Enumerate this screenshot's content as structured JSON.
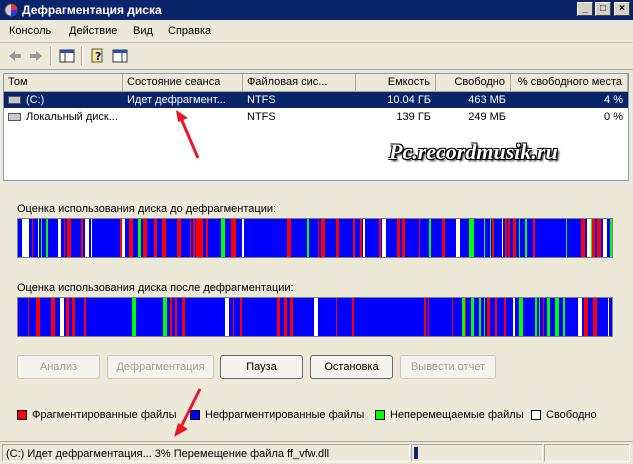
{
  "window": {
    "title": "Дефрагментация диска",
    "min_glyph": "_",
    "max_glyph": "□",
    "close_glyph": "×"
  },
  "menu": [
    "Консоль",
    "Действие",
    "Вид",
    "Справка"
  ],
  "toolbar": {
    "icons": [
      "back-arrow-icon",
      "forward-arrow-icon",
      "show-hide-console-tree-icon",
      "help-icon",
      "properties-icon"
    ]
  },
  "list": {
    "headers": [
      "Том",
      "Состояние сеанса",
      "Файловая сис...",
      "Емкость",
      "Свободно",
      "% свободного места"
    ],
    "rows": [
      {
        "volume": "(C:)",
        "status": "Идет дефрагмент...",
        "fs": "NTFS",
        "capacity": "10.04 ГБ",
        "free": "463 МБ",
        "free_pct": "4 %",
        "selected": true
      },
      {
        "volume": "Локальный диск...",
        "status": "",
        "fs": "NTFS",
        "capacity": "139 ГБ",
        "free": "249 МБ",
        "free_pct": "0 %",
        "selected": false
      }
    ]
  },
  "watermark": "Pc.recordmusik.ru",
  "analysis": {
    "before_label": "Оценка использования диска до дефрагментации:",
    "after_label": "Оценка использования диска после дефрагментации:"
  },
  "buttons": {
    "analyze": "Анализ",
    "defrag": "Дефрагментация",
    "pause": "Пауза",
    "stop": "Остановка",
    "report": "Вывести отчет"
  },
  "legend": {
    "fragmented": "Фрагментированные файлы",
    "contiguous": "Нефрагментированные файлы",
    "unmovable": "Неперемещаемые файлы",
    "free": "Свободно"
  },
  "colors": {
    "fragmented": "#ff0000",
    "contiguous": "#0000ff",
    "unmovable": "#00ff00",
    "free": "#ffffff",
    "selection": "#0a246a",
    "annotation_arrow": "#e8172a"
  },
  "status": {
    "text": "(C:) Идет дефрагментация... 3%  Перемещение файла ff_vfw.dll",
    "progress_fraction": 0.03
  }
}
